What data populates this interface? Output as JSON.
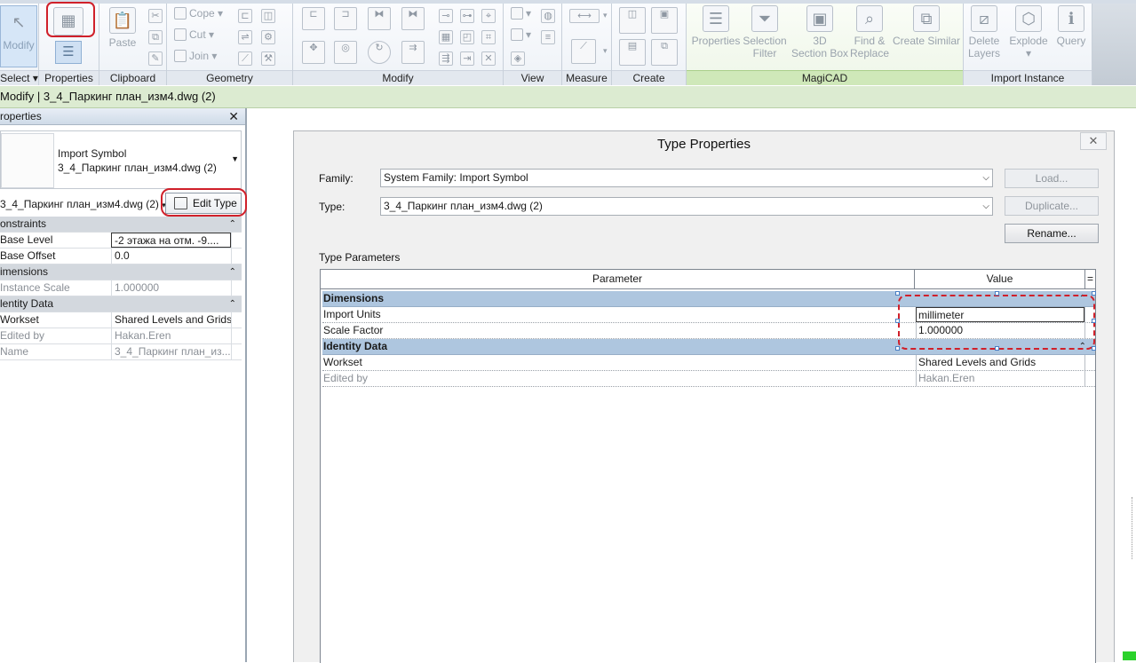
{
  "ribbon": {
    "panels": {
      "select": "Select",
      "properties": "Properties",
      "clipboard": "Clipboard",
      "geometry": "Geometry",
      "modify": "Modify",
      "view": "View",
      "measure": "Measure",
      "create": "Create",
      "magicad": "MagiCAD",
      "import_instance": "Import Instance"
    },
    "buttons": {
      "modify": "Modify",
      "paste": "Paste",
      "cope": "Cope",
      "cut": "Cut",
      "join": "Join",
      "properties": "Properties",
      "selection_filter_1": "Selection",
      "selection_filter_2": "Filter",
      "section_box_1": "3D",
      "section_box_2": "Section Box",
      "find_replace_1": "Find &",
      "find_replace_2": "Replace",
      "create_similar": "Create Similar",
      "delete_layers_1": "Delete",
      "delete_layers_2": "Layers",
      "explode": "Explode",
      "query": "Query"
    }
  },
  "context_bar": "Modify | 3_4_Паркинг план_изм4.dwg (2)",
  "properties_palette": {
    "title": "roperties",
    "type_family": "Import Symbol",
    "type_name": "3_4_Паркинг план_изм4.dwg (2)",
    "instance_selector": "3_4_Паркинг план_изм4.dwg (2)",
    "edit_type": "Edit Type",
    "rows": [
      {
        "kind": "cat",
        "label": "onstraints"
      },
      {
        "kind": "row",
        "label": "Base Level",
        "value": "-2 этажа на отм. -9....",
        "editing": true
      },
      {
        "kind": "row",
        "label": "Base Offset",
        "value": "0.0"
      },
      {
        "kind": "cat",
        "label": "imensions"
      },
      {
        "kind": "grey",
        "label": "Instance Scale",
        "value": "1.000000"
      },
      {
        "kind": "cat",
        "label": "lentity Data"
      },
      {
        "kind": "row",
        "label": "Workset",
        "value": "Shared Levels and Grids"
      },
      {
        "kind": "grey",
        "label": "Edited by",
        "value": "Hakan.Eren"
      },
      {
        "kind": "grey",
        "label": "Name",
        "value": "3_4_Паркинг план_из..."
      }
    ]
  },
  "dialog": {
    "title": "Type Properties",
    "close": "✕",
    "family_label": "Family:",
    "family_value": "System Family: Import Symbol",
    "type_label": "Type:",
    "type_value": "3_4_Паркинг план_изм4.dwg (2)",
    "load": "Load...",
    "duplicate": "Duplicate...",
    "rename": "Rename...",
    "type_parameters": "Type Parameters",
    "col_parameter": "Parameter",
    "col_value": "Value",
    "col_eq": "=",
    "rows": [
      {
        "kind": "cat",
        "param": "Dimensions"
      },
      {
        "kind": "row",
        "param": "Import Units",
        "value": "millimeter",
        "editing": true
      },
      {
        "kind": "row",
        "param": "Scale Factor",
        "value": "1.000000"
      },
      {
        "kind": "cat",
        "param": "Identity Data"
      },
      {
        "kind": "row",
        "param": "Workset",
        "value": "Shared Levels and Grids"
      },
      {
        "kind": "grey",
        "param": "Edited by",
        "value": "Hakan.Eren"
      }
    ]
  },
  "colors": {
    "annotation_red": "#d0202a",
    "category_blue": "#aec6df",
    "context_green": "#dcebd1"
  }
}
